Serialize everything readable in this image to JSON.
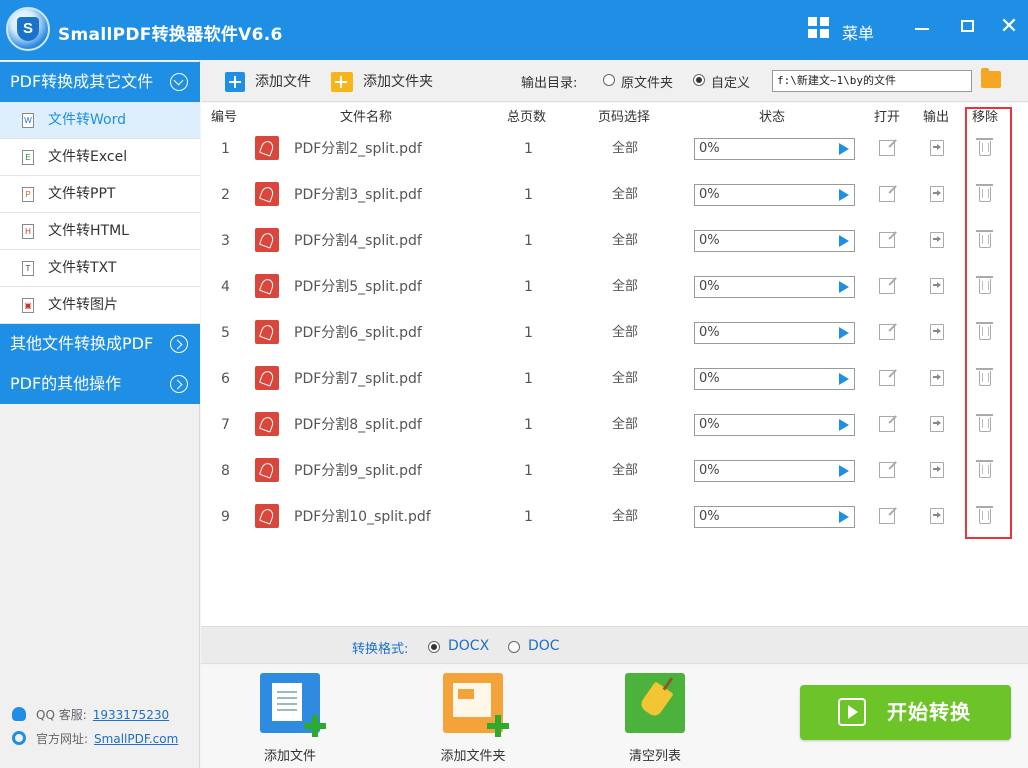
{
  "window": {
    "title": "SmallPDF转换器软件V6.6",
    "logo_letter": "S",
    "menu_label": "菜单",
    "minimize_label": "",
    "maximize_label": "",
    "close_label": "✕"
  },
  "sidebar": {
    "category1": "PDF转换成其它文件",
    "items": [
      {
        "label": "文件转Word",
        "icon": "W",
        "active": true
      },
      {
        "label": "文件转Excel",
        "icon": "E",
        "active": false
      },
      {
        "label": "文件转PPT",
        "icon": "P",
        "active": false
      },
      {
        "label": "文件转HTML",
        "icon": "H",
        "active": false
      },
      {
        "label": "文件转TXT",
        "icon": "T",
        "active": false
      },
      {
        "label": "文件转图片",
        "icon": "▣",
        "active": false
      }
    ],
    "category2": "其他文件转换成PDF",
    "category3": "PDF的其他操作",
    "qq_label": "QQ 客服:",
    "qq_value": "1933175230",
    "site_label": "官方网址:",
    "site_value": "SmallPDF.com"
  },
  "toolbar": {
    "add_file": "添加文件",
    "add_folder": "添加文件夹",
    "output_dir_label": "输出目录:",
    "radio_original": "原文件夹",
    "radio_custom": "自定义",
    "custom_selected": true,
    "output_path": "f:\\新建文~1\\by的文件"
  },
  "table": {
    "headers": {
      "index": "编号",
      "name": "文件名称",
      "pages": "总页数",
      "page_select": "页码选择",
      "status": "状态",
      "open": "打开",
      "output": "输出",
      "remove": "移除"
    },
    "rows": [
      {
        "index": "1",
        "name": "PDF分割2_split.pdf",
        "pages": "1",
        "page_select": "全部",
        "progress": "0%"
      },
      {
        "index": "2",
        "name": "PDF分割3_split.pdf",
        "pages": "1",
        "page_select": "全部",
        "progress": "0%"
      },
      {
        "index": "3",
        "name": "PDF分割4_split.pdf",
        "pages": "1",
        "page_select": "全部",
        "progress": "0%"
      },
      {
        "index": "4",
        "name": "PDF分割5_split.pdf",
        "pages": "1",
        "page_select": "全部",
        "progress": "0%"
      },
      {
        "index": "5",
        "name": "PDF分割6_split.pdf",
        "pages": "1",
        "page_select": "全部",
        "progress": "0%"
      },
      {
        "index": "6",
        "name": "PDF分割7_split.pdf",
        "pages": "1",
        "page_select": "全部",
        "progress": "0%"
      },
      {
        "index": "7",
        "name": "PDF分割8_split.pdf",
        "pages": "1",
        "page_select": "全部",
        "progress": "0%"
      },
      {
        "index": "8",
        "name": "PDF分割9_split.pdf",
        "pages": "1",
        "page_select": "全部",
        "progress": "0%"
      },
      {
        "index": "9",
        "name": "PDF分割10_split.pdf",
        "pages": "1",
        "page_select": "全部",
        "progress": "0%"
      }
    ]
  },
  "format": {
    "label": "转换格式:",
    "options": [
      "DOCX",
      "DOC"
    ],
    "selected": "DOCX"
  },
  "bottom": {
    "add_file": "添加文件",
    "add_folder": "添加文件夹",
    "clear_list": "清空列表",
    "start": "开始转换"
  },
  "colors": {
    "brand_blue": "#1f8fe5",
    "start_green": "#6cc428",
    "highlight_red": "#e8343a",
    "pdf_red": "#d9463c"
  }
}
